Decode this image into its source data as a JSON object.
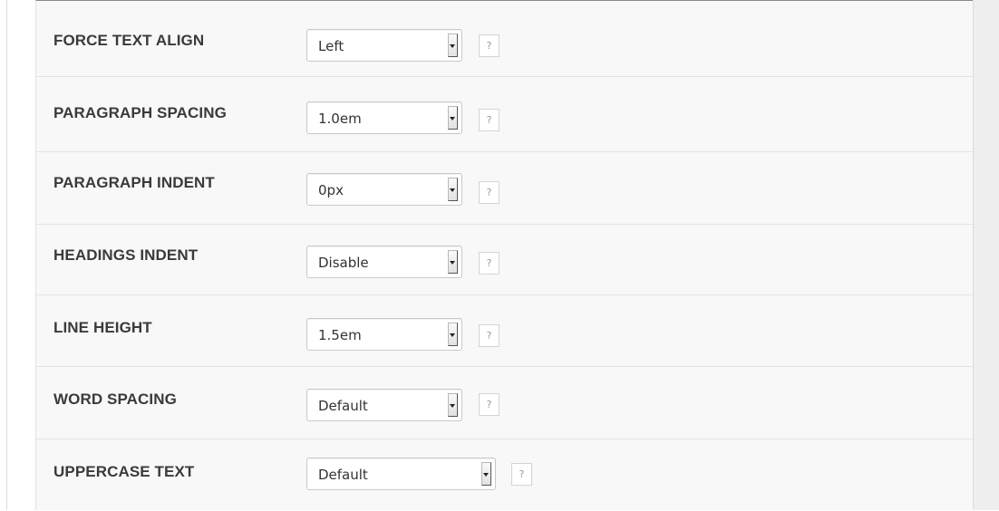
{
  "settings": {
    "rows": [
      {
        "label": "FORCE TEXT ALIGN",
        "value": "Left",
        "help": "?"
      },
      {
        "label": "PARAGRAPH SPACING",
        "value": "1.0em",
        "help": "?"
      },
      {
        "label": "PARAGRAPH INDENT",
        "value": "0px",
        "help": "?"
      },
      {
        "label": "HEADINGS INDENT",
        "value": "Disable",
        "help": "?"
      },
      {
        "label": "LINE HEIGHT",
        "value": "1.5em",
        "help": "?"
      },
      {
        "label": "WORD SPACING",
        "value": "Default",
        "help": "?"
      },
      {
        "label": "UPPERCASE TEXT",
        "value": "Default",
        "help": "?"
      }
    ]
  },
  "icons": {
    "dropdown": "chevron-down-icon",
    "help": "help-icon"
  },
  "colors": {
    "panel_background": "#f8f8f8",
    "label_text": "#3a3a3a",
    "row_divider": "#e3e3e3"
  }
}
